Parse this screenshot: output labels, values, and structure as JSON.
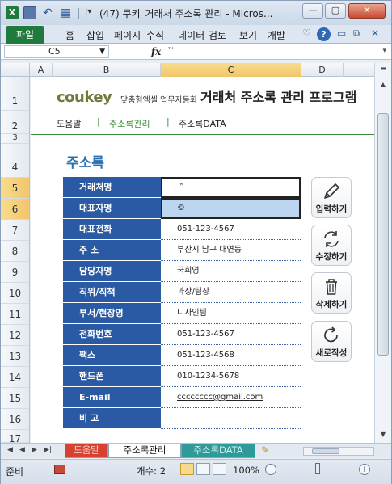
{
  "window": {
    "title": "(47) 쿠키_거래처 주소록 관리 - Micros...",
    "min_label": "—",
    "max_label": "▢",
    "close_label": "✕",
    "logo_label": "X"
  },
  "qat": {
    "more": "|▾"
  },
  "ribbon": {
    "file_tab": "파일",
    "tabs": [
      "홈",
      "삽입",
      "페이지",
      "수식",
      "데이터",
      "검토",
      "보기",
      "개발"
    ],
    "help": "?"
  },
  "formula_bar": {
    "namebox": "C5",
    "fx": "fx",
    "value": "™"
  },
  "columns": [
    "A",
    "B",
    "C",
    "D"
  ],
  "rows": [
    "1",
    "2",
    "3",
    "4",
    "5",
    "6",
    "7",
    "8",
    "9",
    "10",
    "11",
    "12",
    "13",
    "14",
    "15",
    "16",
    "17"
  ],
  "header": {
    "brand": "coukey",
    "tagline": "맞춤형엑셀 업무자동화",
    "title": "거래처 주소록 관리 프로그램"
  },
  "nav": {
    "items": [
      "도움말",
      "주소록관리",
      "주소록DATA"
    ],
    "separator": "|"
  },
  "section_title": "주소록",
  "form": {
    "rows": [
      {
        "label": "거래처명",
        "value": "™"
      },
      {
        "label": "대표자명",
        "value": "©"
      },
      {
        "label": "대표전화",
        "value": "051-123-4567"
      },
      {
        "label": "주 소",
        "value": "부산시 남구 대연동"
      },
      {
        "label": "담당자명",
        "value": "국희영"
      },
      {
        "label": "직위/직책",
        "value": "과장/팀장"
      },
      {
        "label": "부서/현장명",
        "value": "디자인팀"
      },
      {
        "label": "전화번호",
        "value": "051-123-4567"
      },
      {
        "label": "팩스",
        "value": "051-123-4568"
      },
      {
        "label": "핸드폰",
        "value": "010-1234-5678"
      },
      {
        "label": "E-mail",
        "value": "cccccccc@gmail.com"
      },
      {
        "label": "비 고",
        "value": ""
      }
    ]
  },
  "actions": {
    "insert": "입력하기",
    "edit": "수정하기",
    "delete": "삭제하기",
    "new": "새로작성"
  },
  "sheet_tabs": {
    "nav": [
      "|◀",
      "◀",
      "▶",
      "▶|"
    ],
    "tabs": [
      "도움말",
      "주소록관리",
      "주소록DATA"
    ]
  },
  "status": {
    "ready": "준비",
    "count": "개수: 2",
    "zoom": "100%",
    "zoom_minus": "−",
    "zoom_plus": "+"
  },
  "colors": {
    "label_bg": "#2a5aa3",
    "accent_green": "#3a8a3a",
    "section_blue": "#2a6fb4",
    "selection": "#bcd6f0"
  }
}
